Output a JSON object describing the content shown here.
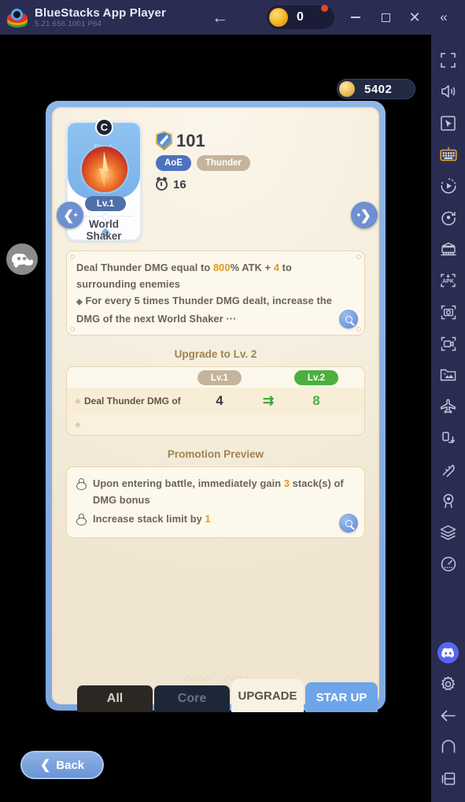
{
  "titlebar": {
    "app_name": "BlueStacks App Player",
    "version": "5.21.656.1001  P64",
    "back_icon": "arrow-left-icon",
    "coin_count": "0",
    "minimize_label": "—",
    "maximize_label": "",
    "close_label": "✕",
    "collapse_label": "«"
  },
  "game": {
    "currency": {
      "icon": "gold-coin-icon",
      "amount": "5402"
    },
    "chat_icon": "chat-bubble-icon",
    "nav_left_icon": "chevron-left-icon",
    "nav_right_icon": "chevron-right-icon",
    "hero": {
      "rank_letter": "C",
      "exclusive_label": "Excl.",
      "level_label": "Lv.1",
      "name_line1": "World",
      "name_line2": "Shaker",
      "power_value": "101",
      "power_icon": "shield-sword-icon",
      "tags": [
        "AoE",
        "Thunder"
      ],
      "cooldown_icon": "timer-icon",
      "cooldown_value": "16"
    },
    "description": {
      "line1_a": "Deal Thunder DMG equal to ",
      "line1_hl1": "800",
      "line1_b": "% ATK + ",
      "line1_hl2": "4",
      "line1_c": " to surrounding enemies",
      "bullet": "◆",
      "line2": " For every 5 times Thunder DMG dealt, increase the DMG of the next World Shaker ",
      "ellipsis": "···",
      "magnifier_icon": "magnifier-icon"
    },
    "upgrade": {
      "section_title": "Upgrade to Lv. 2",
      "col_old": "Lv.1",
      "col_new": "Lv.2",
      "rows": [
        {
          "label": "Deal Thunder DMG of",
          "old": "4",
          "arrow": "⇉",
          "new": "8"
        },
        {
          "label": "",
          "old": "",
          "arrow": "",
          "new": ""
        }
      ]
    },
    "promotion": {
      "section_title": "Promotion Preview",
      "items": [
        {
          "icon": "lock-icon",
          "text_a": "Upon entering battle, immediately gain ",
          "hl": "3",
          "text_b": " stack(s) of DMG bonus"
        },
        {
          "icon": "lock-icon",
          "text_a": "Increase stack limit by ",
          "hl": "1",
          "text_b": ""
        }
      ],
      "magnifier_icon": "magnifier-icon"
    },
    "tabs": [
      {
        "label": "All",
        "state": "inactive"
      },
      {
        "label": "Core",
        "state": "inactive"
      },
      {
        "label": "UPGRADE",
        "state": "active"
      },
      {
        "label": "STAR UP",
        "state": "inactive"
      }
    ],
    "back_button": {
      "icon": "chevron-left-icon",
      "label": "Back"
    }
  },
  "sidebar": {
    "items": [
      {
        "name": "fullscreen-icon"
      },
      {
        "name": "volume-icon"
      },
      {
        "name": "cursor-pointer-icon"
      },
      {
        "name": "keyboard-controls-icon",
        "highlighted": true
      },
      {
        "name": "macro-play-icon"
      },
      {
        "name": "rotate-icon"
      },
      {
        "name": "multi-instance-icon"
      },
      {
        "name": "apk-install-icon"
      },
      {
        "name": "screenshot-icon"
      },
      {
        "name": "record-video-icon"
      },
      {
        "name": "media-manager-icon"
      },
      {
        "name": "airplane-mode-icon"
      },
      {
        "name": "shake-icon"
      },
      {
        "name": "eco-mode-icon"
      },
      {
        "name": "location-icon"
      },
      {
        "name": "layers-icon"
      },
      {
        "name": "performance-icon"
      },
      {
        "name": "discord-icon",
        "highlighted": true
      },
      {
        "name": "settings-gear-icon"
      },
      {
        "name": "back-arrow-icon"
      },
      {
        "name": "home-icon"
      },
      {
        "name": "recent-apps-icon"
      }
    ]
  },
  "colors": {
    "titlebar_bg": "#2a2d51",
    "card_border": "#7fa9e2",
    "card_paper": "#f6efe0",
    "accent_orange": "#e09a1e",
    "accent_green": "#4caf3f",
    "tag_aoe": "#4d72bf",
    "tag_element": "#c5b49b",
    "discord_blurple": "#5865f2"
  }
}
